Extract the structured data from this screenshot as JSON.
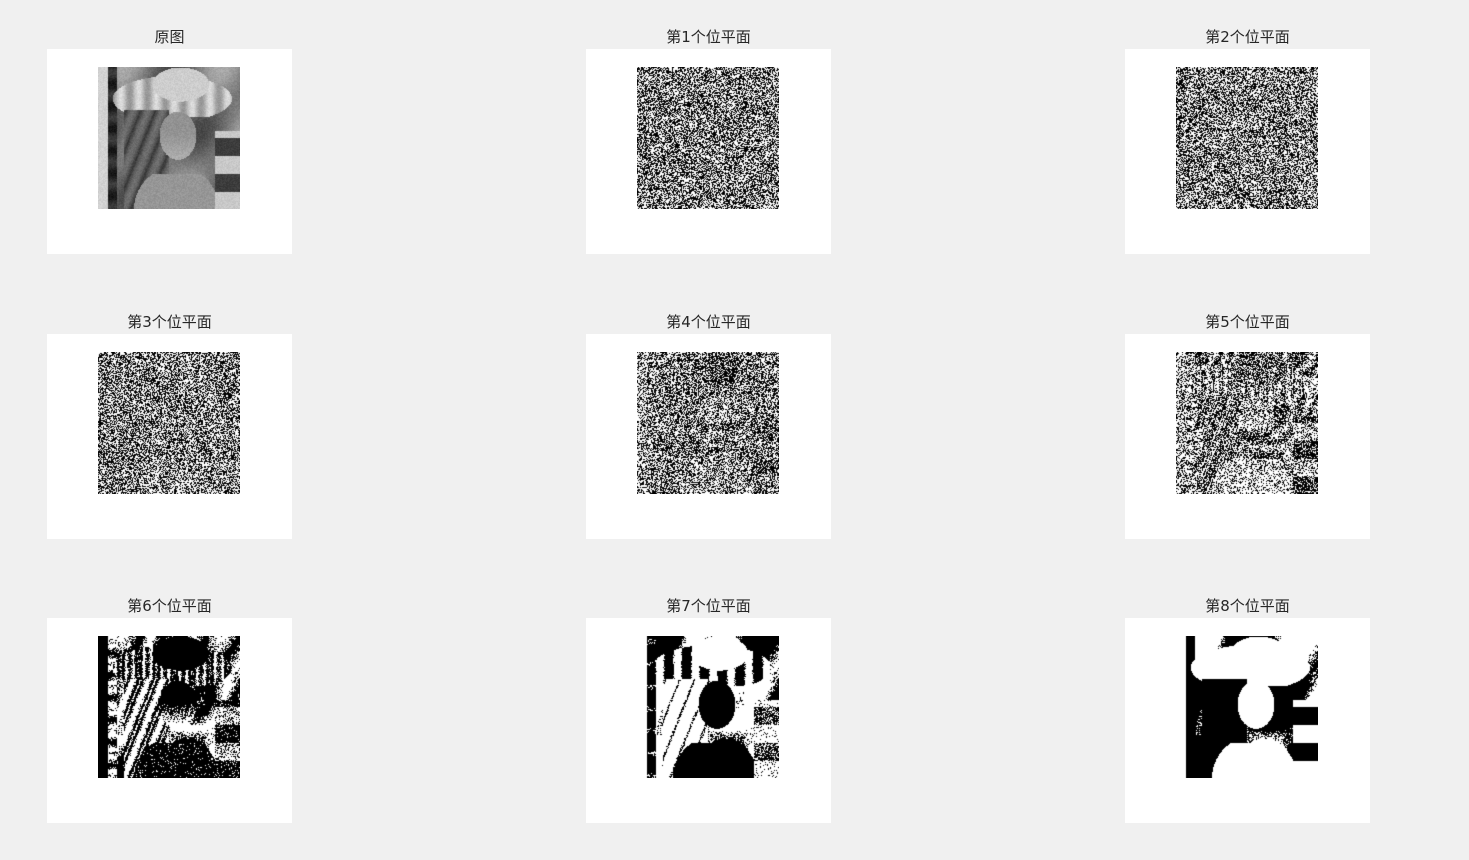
{
  "figure": {
    "background": "#f0f0f0",
    "axes_background": "#ffffff",
    "title_color": "#262626"
  },
  "panels": [
    {
      "title": "原图",
      "kind": "original",
      "content": "grayscale portrait: woman wearing a wide-brimmed hat, looking over her shoulder"
    },
    {
      "title": "第1个位平面",
      "kind": "bitplane",
      "bit": 1
    },
    {
      "title": "第2个位平面",
      "kind": "bitplane",
      "bit": 2
    },
    {
      "title": "第3个位平面",
      "kind": "bitplane",
      "bit": 3
    },
    {
      "title": "第4个位平面",
      "kind": "bitplane",
      "bit": 4
    },
    {
      "title": "第5个位平面",
      "kind": "bitplane",
      "bit": 5
    },
    {
      "title": "第6个位平面",
      "kind": "bitplane",
      "bit": 6
    },
    {
      "title": "第7个位平面",
      "kind": "bitplane",
      "bit": 7
    },
    {
      "title": "第8个位平面",
      "kind": "bitplane",
      "bit": 8
    }
  ]
}
